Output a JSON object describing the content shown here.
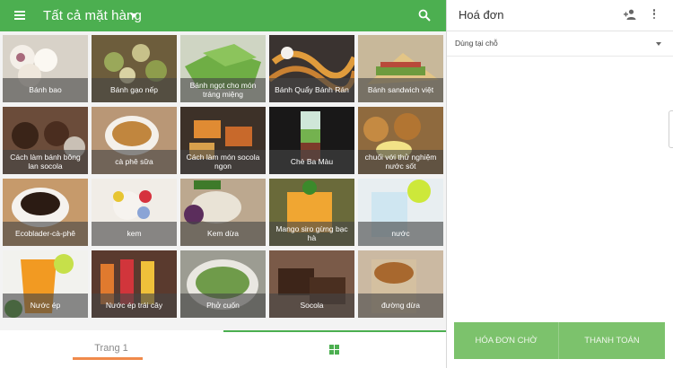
{
  "header": {
    "category_label": "Tất cả mặt hàng",
    "icons": {
      "menu": "menu-icon",
      "dropdown": "caret-down-icon",
      "search": "search-icon"
    }
  },
  "items": [
    {
      "label": "Bánh bao"
    },
    {
      "label": "Bánh gạo nếp"
    },
    {
      "label": "Bánh ngọt cho món tráng miệng"
    },
    {
      "label": "Bánh Quẩy Bánh Rán"
    },
    {
      "label": "Bánh sandwich việt"
    },
    {
      "label": "Cách làm bánh bông lan socola"
    },
    {
      "label": "cà phê sữa"
    },
    {
      "label": "Cách làm món socola ngon"
    },
    {
      "label": "Chè Ba Màu"
    },
    {
      "label": "chuối với thử nghiệm nước sốt"
    },
    {
      "label": "Ecoblader-cà-phê"
    },
    {
      "label": "kem"
    },
    {
      "label": "Kem dừa"
    },
    {
      "label": "Mango siro gừng bạc hà"
    },
    {
      "label": "nước"
    },
    {
      "label": "Nước ép"
    },
    {
      "label": "Nước ép trái cây"
    },
    {
      "label": "Phở cuốn"
    },
    {
      "label": "Socola"
    },
    {
      "label": "đường dừa"
    }
  ],
  "footer": {
    "page_label": "Trang 1",
    "grid_icon": "grid-view-icon"
  },
  "invoice": {
    "title": "Hoá đơn",
    "dining_option": "Dùng tại chỗ",
    "icons": {
      "add_customer": "add-person-icon",
      "more": "more-vertical-icon"
    },
    "hold_label": "HÓA ĐƠN CHỜ",
    "pay_label": "THANH TOÁN"
  },
  "colors": {
    "primary_green": "#4caf50",
    "action_green": "#7cc26c",
    "page_underline": "#f08a4b"
  }
}
